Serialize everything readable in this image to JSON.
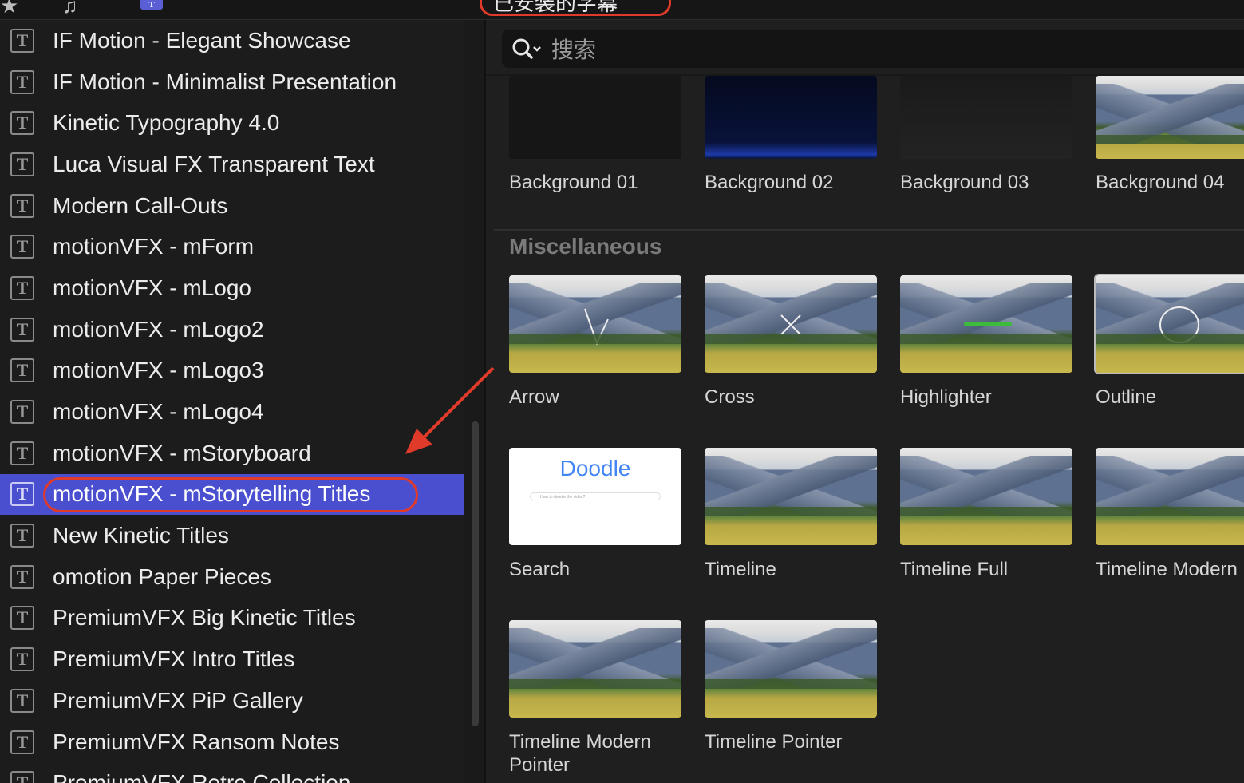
{
  "toolbar": {
    "star_icon": "★",
    "music_icon": "♫",
    "title_icon": "T",
    "dropdown_label": "已安装的字幕"
  },
  "sidebar": {
    "items": [
      {
        "label": "IF Motion - Elegant Showcase"
      },
      {
        "label": "IF Motion - Minimalist Presentation"
      },
      {
        "label": "Kinetic Typography 4.0"
      },
      {
        "label": "Luca Visual FX Transparent Text"
      },
      {
        "label": "Modern Call-Outs"
      },
      {
        "label": "motionVFX - mForm"
      },
      {
        "label": "motionVFX - mLogo"
      },
      {
        "label": "motionVFX - mLogo2"
      },
      {
        "label": "motionVFX - mLogo3"
      },
      {
        "label": "motionVFX - mLogo4"
      },
      {
        "label": "motionVFX - mStoryboard"
      },
      {
        "label": "motionVFX - mStorytelling Titles"
      },
      {
        "label": "New Kinetic Titles"
      },
      {
        "label": "omotion Paper Pieces"
      },
      {
        "label": "PremiumVFX Big Kinetic Titles"
      },
      {
        "label": "PremiumVFX Intro Titles"
      },
      {
        "label": "PremiumVFX PiP Gallery"
      },
      {
        "label": "PremiumVFX Ransom Notes"
      },
      {
        "label": "PremiumVFX Retro Collection"
      }
    ],
    "selected_index": 11,
    "item_icon": "T"
  },
  "browser": {
    "search_placeholder": "搜索",
    "background_tiles": [
      {
        "label": "Background 01"
      },
      {
        "label": "Background 02"
      },
      {
        "label": "Background 03"
      },
      {
        "label": "Background 04"
      }
    ],
    "section_title": "Miscellaneous",
    "misc_tiles": [
      {
        "label": "Arrow"
      },
      {
        "label": "Cross"
      },
      {
        "label": "Highlighter"
      },
      {
        "label": "Outline"
      },
      {
        "label": "Search"
      },
      {
        "label": "Timeline"
      },
      {
        "label": "Timeline Full"
      },
      {
        "label": "Timeline Modern"
      },
      {
        "label": "Timeline Modern Pointer"
      },
      {
        "label": "Timeline Pointer"
      }
    ],
    "doodle_logo": "Doodle",
    "doodle_search_text": "How to doodle the video?"
  },
  "colors": {
    "selection": "#4a4fd0",
    "annotation": "#e03a2a",
    "background": "#1f1f1f"
  }
}
